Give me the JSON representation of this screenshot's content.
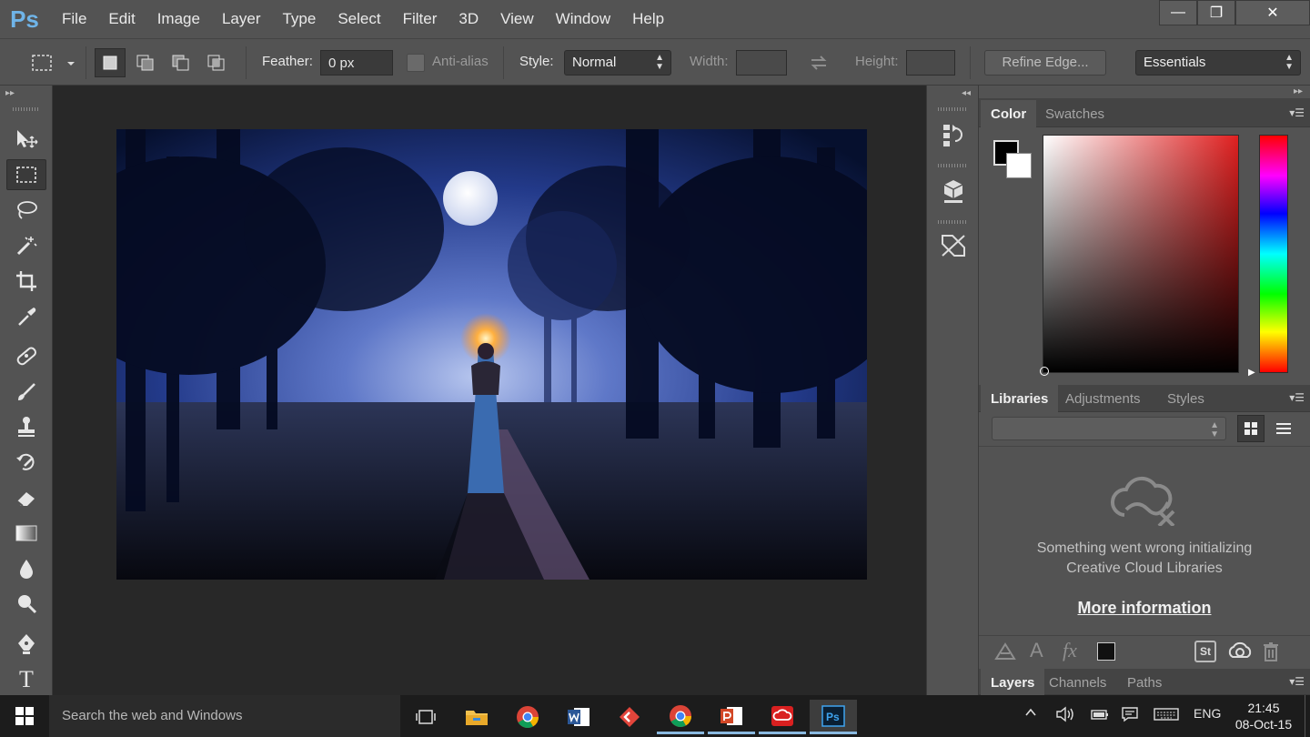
{
  "app": {
    "logo": "Ps"
  },
  "menu": [
    "File",
    "Edit",
    "Image",
    "Layer",
    "Type",
    "Select",
    "Filter",
    "3D",
    "View",
    "Window",
    "Help"
  ],
  "window_controls": {
    "minimize": "—",
    "restore": "❐",
    "close": "✕"
  },
  "options": {
    "feather_label": "Feather:",
    "feather_value": "0 px",
    "antialias_label": "Anti-alias",
    "style_label": "Style:",
    "style_value": "Normal",
    "width_label": "Width:",
    "height_label": "Height:",
    "refine_edge": "Refine Edge...",
    "workspace": "Essentials"
  },
  "color_panel": {
    "tabs": [
      "Color",
      "Swatches"
    ],
    "foreground": "#000000",
    "background": "#ffffff",
    "hue": "#e02020"
  },
  "libraries_panel": {
    "tabs": [
      "Libraries",
      "Adjustments",
      "Styles"
    ],
    "error_line1": "Something went wrong initializing",
    "error_line2": "Creative Cloud Libraries",
    "more_info": "More information",
    "footer_text_glyph": "A",
    "footer_fx_glyph": "fx",
    "footer_stock": "St"
  },
  "layers_panel": {
    "tabs": [
      "Layers",
      "Channels",
      "Paths"
    ]
  },
  "tools": [
    "move-tool",
    "marquee-tool",
    "lasso-tool",
    "magic-wand-tool",
    "crop-tool",
    "eyedropper-tool",
    "healing-brush-tool",
    "brush-tool",
    "clone-stamp-tool",
    "history-brush-tool",
    "eraser-tool",
    "gradient-tool",
    "blur-tool",
    "dodge-tool",
    "pen-tool",
    "type-tool"
  ],
  "type_tool_glyph": "T",
  "taskbar": {
    "search_placeholder": "Search the web and Windows",
    "language": "ENG",
    "time": "21:45",
    "date": "08-Oct-15"
  }
}
